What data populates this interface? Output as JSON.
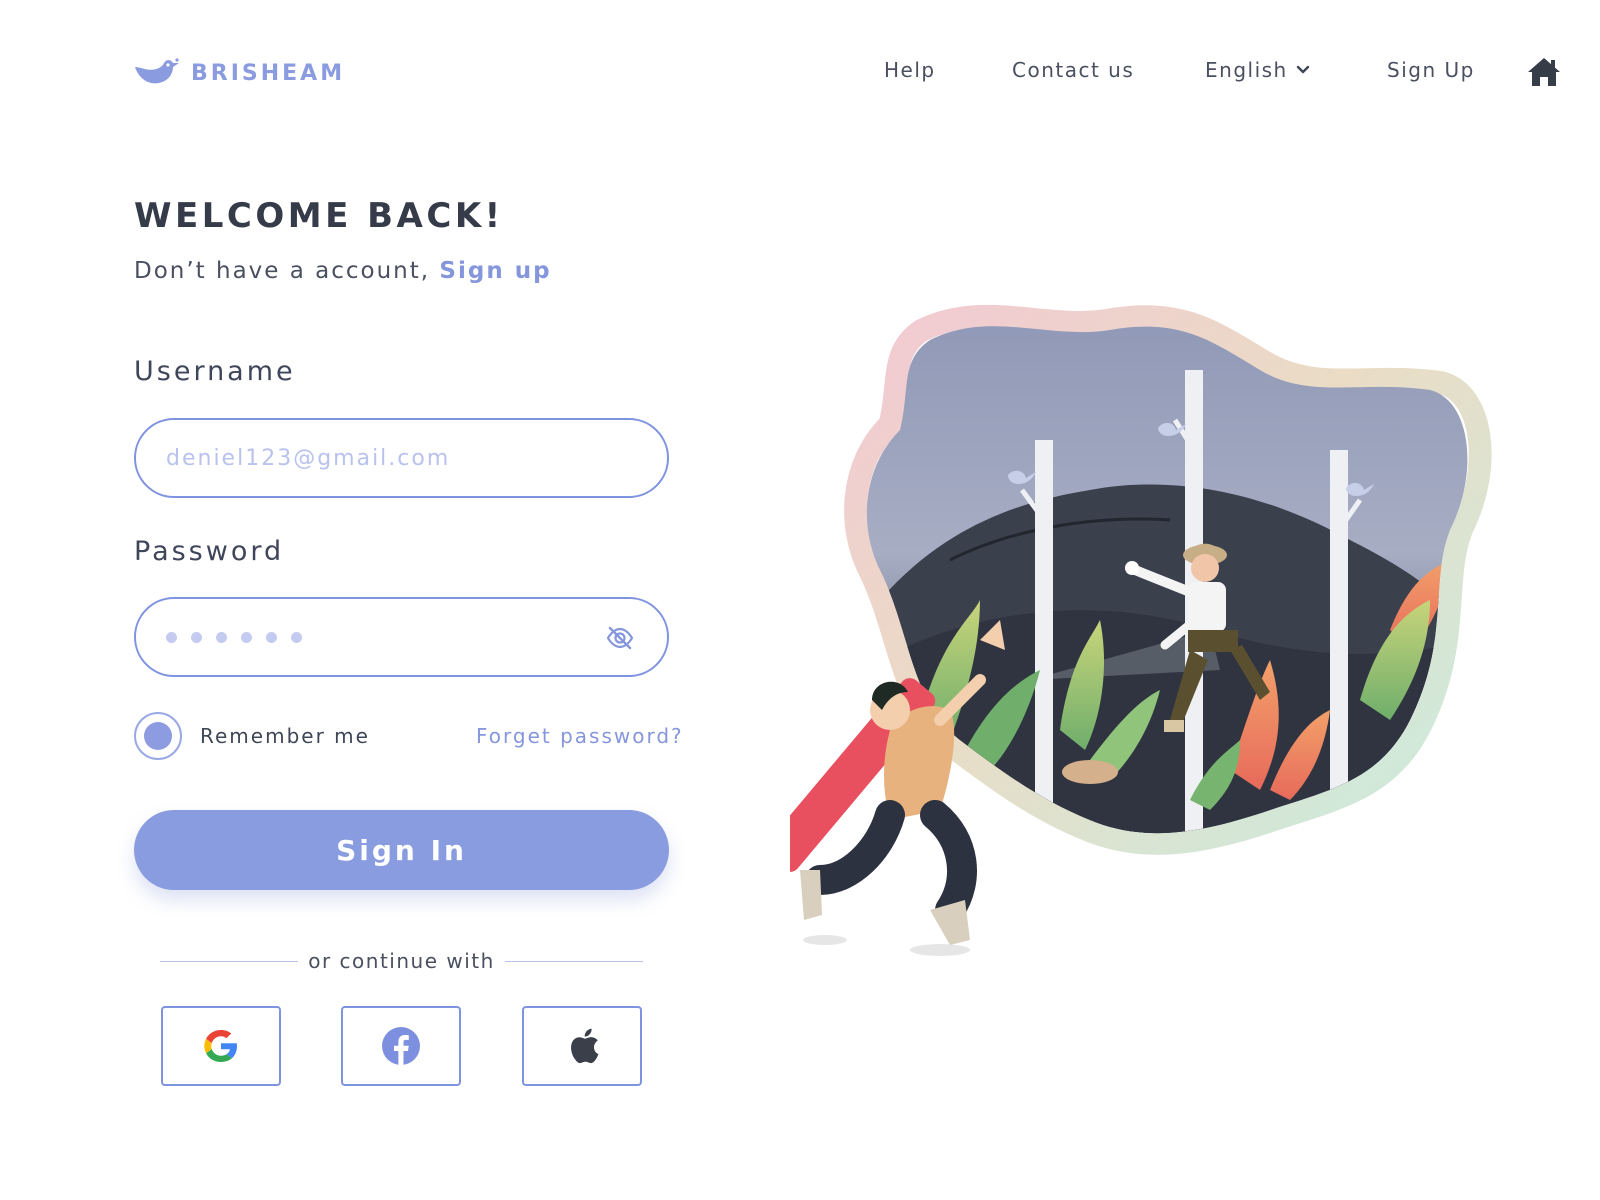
{
  "brand": {
    "name": "BRISHEAM",
    "color": "#8b9be0",
    "logo_icon": "bird-icon"
  },
  "nav": {
    "items": [
      {
        "label": "Help"
      },
      {
        "label": "Contact us"
      },
      {
        "label": "English",
        "icon": "chevron-down-icon"
      },
      {
        "label": "Sign Up"
      }
    ],
    "home_icon": "home-icon"
  },
  "welcome": {
    "title": "WELCOME BACK!",
    "subtitle": "Don’t have a account,",
    "signup_link": "Sign up"
  },
  "form": {
    "username_label": "Username",
    "username_placeholder": "deniel123@gmail.com",
    "password_label": "Password",
    "password_masked_length": 6,
    "password_toggle_icon": "eye-off-icon",
    "remember_label": "Remember me",
    "remember_checked": true,
    "forgot_label": "Forget password?",
    "signin_label": "Sign In"
  },
  "social": {
    "divider_text": "or continue with",
    "providers": [
      {
        "name": "google",
        "icon": "google-icon"
      },
      {
        "name": "facebook",
        "icon": "facebook-icon"
      },
      {
        "name": "apple",
        "icon": "apple-icon"
      }
    ]
  },
  "colors": {
    "accent": "#8a9ce0",
    "border": "#7f93e0",
    "text_dark": "#353b48",
    "link": "#8596dd"
  },
  "illustration": {
    "icon": "forest-explorer-illustration"
  }
}
